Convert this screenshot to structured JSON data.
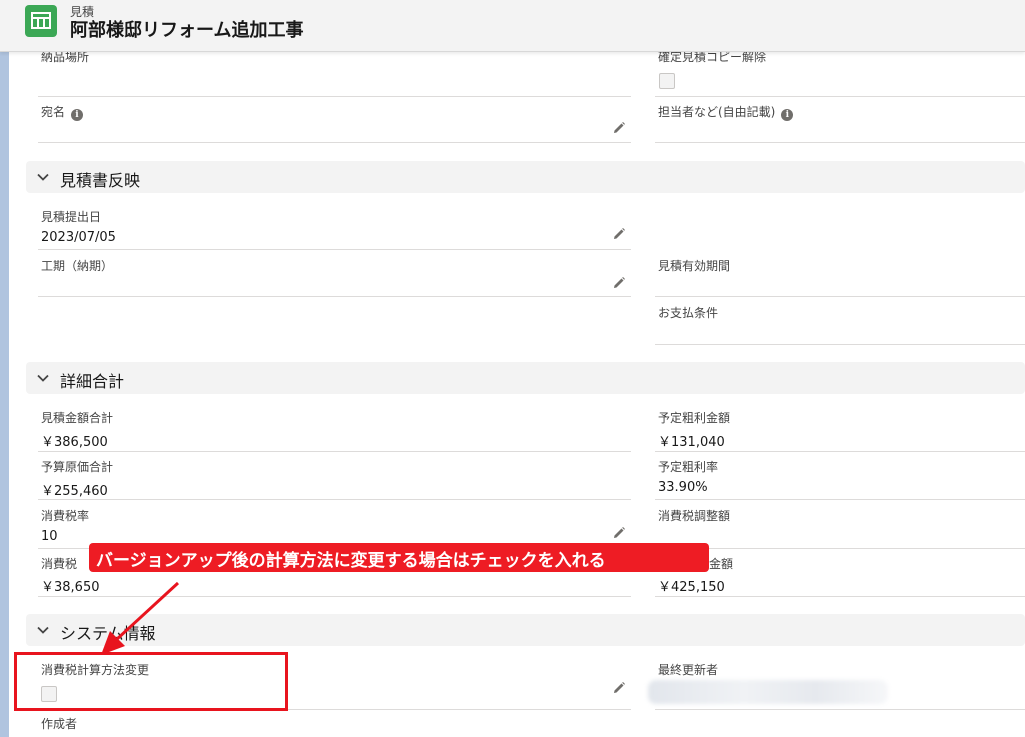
{
  "header": {
    "record_type": "見積",
    "title": "阿部様邸リフォーム追加工事"
  },
  "fields_top": {
    "delivery_place_label": "納品場所",
    "confirm_copy_label": "確定見積コピー解除",
    "addressee_label": "宛名",
    "person_in_charge_label": "担当者など(自由記載)"
  },
  "sections": {
    "estimate_reflect": "見積書反映",
    "detail_total": "詳細合計",
    "system_info": "システム情報"
  },
  "estimate_reflect": {
    "submit_date_label": "見積提出日",
    "submit_date_value": "2023/07/05",
    "period_label": "工期（納期）",
    "valid_period_label": "見積有効期間",
    "payment_terms_label": "お支払条件"
  },
  "detail_total": {
    "total_label": "見積金額合計",
    "total_value": "￥386,500",
    "gross_profit_label": "予定粗利金額",
    "gross_profit_value": "￥131,040",
    "budget_cost_label": "予算原価合計",
    "budget_cost_value": "￥255,460",
    "gross_margin_label": "予定粗利率",
    "gross_margin_value": "33.90%",
    "tax_rate_label": "消費税率",
    "tax_rate_value": "10",
    "tax_adjust_label": "消費税調整額",
    "tax_label": "消費税",
    "tax_value": "￥38,650",
    "tax_incl_label_partial": "金額",
    "tax_incl_value": "￥425,150"
  },
  "system_info": {
    "tax_method_label": "消費税計算方法変更",
    "last_modified_label": "最終更新者",
    "created_by_label": "作成者"
  },
  "annotation": {
    "text": "バージョンアップ後の計算方法に変更する場合はチェックを入れる",
    "color": "#ee1c24"
  },
  "icons": {
    "record": "table-icon",
    "edit": "pencil-icon",
    "info": "info-icon",
    "chevron": "chevron-down-icon"
  },
  "colors": {
    "brand_icon": "#3ba755",
    "section_bg": "#f3f3f3",
    "annotation_red": "#ee1c24"
  }
}
